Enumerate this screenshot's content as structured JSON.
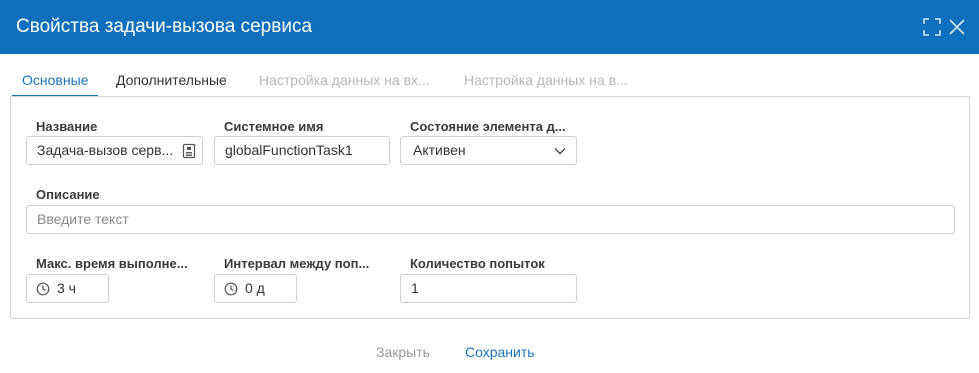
{
  "dialog": {
    "title": "Свойства задачи-вызова сервиса"
  },
  "tabs": [
    {
      "label": "Основные",
      "state": "active"
    },
    {
      "label": "Дополнительные",
      "state": "normal"
    },
    {
      "label": "Настройка данных на вх...",
      "state": "disabled"
    },
    {
      "label": "Настройка данных на в...",
      "state": "disabled"
    }
  ],
  "form": {
    "name": {
      "label": "Название",
      "value": "Задача-вызов серв..."
    },
    "system_name": {
      "label": "Системное имя",
      "value": "globalFunctionTask1"
    },
    "element_state": {
      "label": "Состояние элемента д...",
      "value": "Активен"
    },
    "description": {
      "label": "Описание",
      "placeholder": "Введите текст"
    },
    "max_exec_time": {
      "label": "Макс. время выполне...",
      "value": "3 ч"
    },
    "retry_interval": {
      "label": "Интервал между поп...",
      "value": "0 д"
    },
    "retry_count": {
      "label": "Количество попыток",
      "value": "1"
    }
  },
  "footer": {
    "close_label": "Закрыть",
    "save_label": "Сохранить"
  },
  "colors": {
    "titlebar": "#0f6fba",
    "accent": "#1b75bc",
    "disabled_text": "#b7b7b7"
  },
  "icons": {
    "maximize": "expand-icon",
    "close": "close-icon",
    "field_action": "id-card-icon",
    "time": "clock-icon",
    "dropdown": "chevron-down-icon"
  }
}
